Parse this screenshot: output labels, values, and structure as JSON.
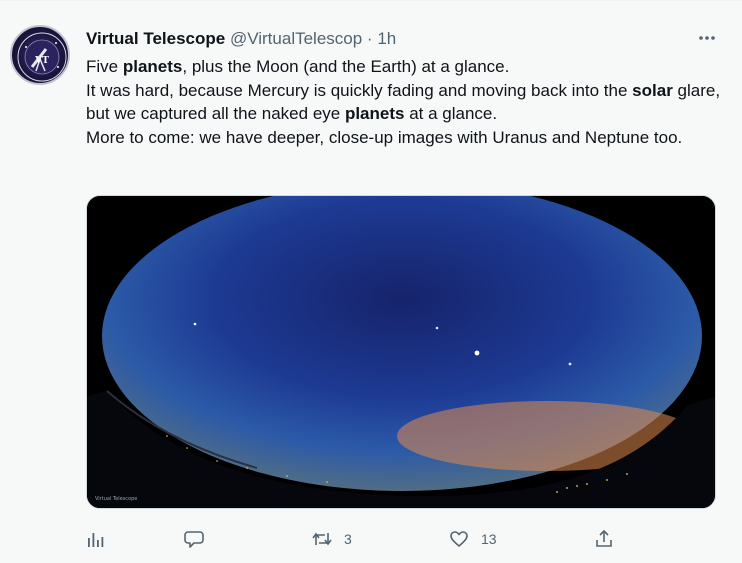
{
  "tweet": {
    "author_name": "Virtual Telescope",
    "handle": "@VirtualTelescop",
    "separator": "·",
    "time": "1h",
    "text": {
      "line1_a": "Five ",
      "line1_b": "planets",
      "line1_c": ", plus the Moon (and the Earth) at a glance.",
      "line2_a": "It was hard, because Mercury is quickly fading and moving back into the ",
      "line2_b": "solar",
      "line2_c": " glare, but we captured all the naked eye ",
      "line2_d": "planets",
      "line2_e": " at a glance.",
      "line3": "More to come: we have deeper, close-up images with Uranus and Neptune too."
    },
    "media": {
      "caption": "Virtual Telescope"
    },
    "actions": {
      "retweets": "3",
      "likes": "13"
    }
  },
  "icons": {
    "analytics": "bar-chart-icon",
    "reply": "speech-bubble-icon",
    "retweet": "retweet-arrows-icon",
    "like": "heart-icon",
    "share": "share-upload-icon",
    "more": "ellipsis-icon"
  },
  "colors": {
    "text_primary": "#0f1419",
    "text_secondary": "#536471",
    "background": "#f7f9f9"
  }
}
